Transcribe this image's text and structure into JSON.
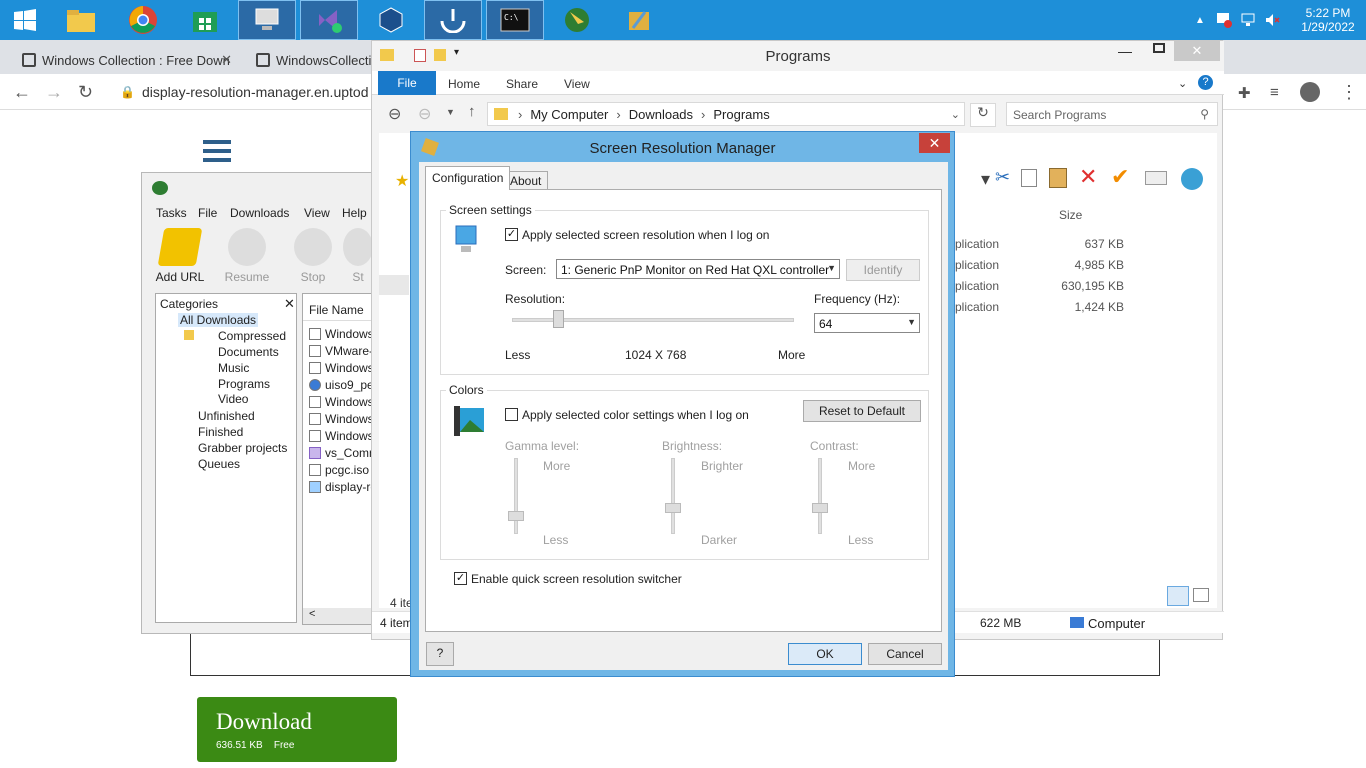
{
  "taskbar": {
    "apps": [
      "start-icon",
      "file-explorer-icon",
      "chrome-icon",
      "store-icon",
      "computer-management-icon",
      "visual-studio-installer-icon",
      "virtualbox-icon",
      "idm-install-icon",
      "command-prompt-icon",
      "idm-icon",
      "setup-icon"
    ],
    "time": "5:22 PM",
    "date": "1/29/2022"
  },
  "browser": {
    "tabs": [
      {
        "title": "Windows Collection : Free Down"
      },
      {
        "title": "WindowsCollectio"
      }
    ],
    "url": "display-resolution-manager.en.uptod",
    "download_button": {
      "label": "Download",
      "size": "636.51 KB",
      "price": "Free"
    }
  },
  "idm": {
    "menu": [
      "Tasks",
      "File",
      "Downloads",
      "View",
      "Help"
    ],
    "toolbar": [
      "Add URL",
      "Resume",
      "Stop",
      "St"
    ],
    "categories_header": "Categories",
    "categories": [
      "All Downloads",
      "Compressed",
      "Documents",
      "Music",
      "Programs",
      "Video",
      "Unfinished",
      "Finished",
      "Grabber projects",
      "Queues"
    ],
    "file_name_header": "File Name",
    "files": [
      "Windows",
      "VMware-w",
      "Windows",
      "uiso9_pe.",
      "Windows",
      "Windows",
      "Windows",
      "vs_Comm",
      "pcgc.iso",
      "display-re"
    ],
    "status": "4 ite"
  },
  "explorer": {
    "title": "Programs",
    "ribbon_tabs": [
      "File",
      "Home",
      "Share",
      "View"
    ],
    "breadcrumb": [
      "My Computer",
      "Downloads",
      "Programs"
    ],
    "search_placeholder": "Search Programs",
    "size_header": "Size",
    "rows": [
      {
        "type": "plication",
        "size": "637 KB"
      },
      {
        "type": "plication",
        "size": "4,985 KB"
      },
      {
        "type": "plication",
        "size": "630,195 KB"
      },
      {
        "type": "plication",
        "size": "1,424 KB"
      }
    ],
    "status_items": "4 item",
    "status_size": "622 MB",
    "status_location": "Computer"
  },
  "dialog": {
    "title": "Screen Resolution Manager",
    "tabs": [
      "Configuration",
      "About"
    ],
    "screen_settings": {
      "group_label": "Screen settings",
      "apply_label": "Apply selected screen resolution when I log on",
      "apply_checked": true,
      "screen_label": "Screen:",
      "screen_value": "1: Generic PnP Monitor on Red Hat QXL controller",
      "identify": "Identify",
      "resolution_label": "Resolution:",
      "resolution_value": "1024 X 768",
      "less": "Less",
      "more": "More",
      "frequency_label": "Frequency (Hz):",
      "frequency_value": "64"
    },
    "colors": {
      "group_label": "Colors",
      "apply_label": "Apply selected color settings when I log on",
      "apply_checked": false,
      "reset": "Reset to Default",
      "gamma": {
        "label": "Gamma level:",
        "top": "More",
        "bottom": "Less"
      },
      "brightness": {
        "label": "Brightness:",
        "top": "Brighter",
        "bottom": "Darker"
      },
      "contrast": {
        "label": "Contrast:",
        "top": "More",
        "bottom": "Less"
      }
    },
    "quick_switch_label": "Enable quick screen resolution switcher",
    "quick_switch_checked": true,
    "ok": "OK",
    "cancel": "Cancel"
  },
  "colors": {
    "taskbar": "#1e8fd8",
    "download_green": "#3b8a14",
    "explorer_file_tab": "#1979ca",
    "dialog_frame": "#6fb6e6"
  }
}
